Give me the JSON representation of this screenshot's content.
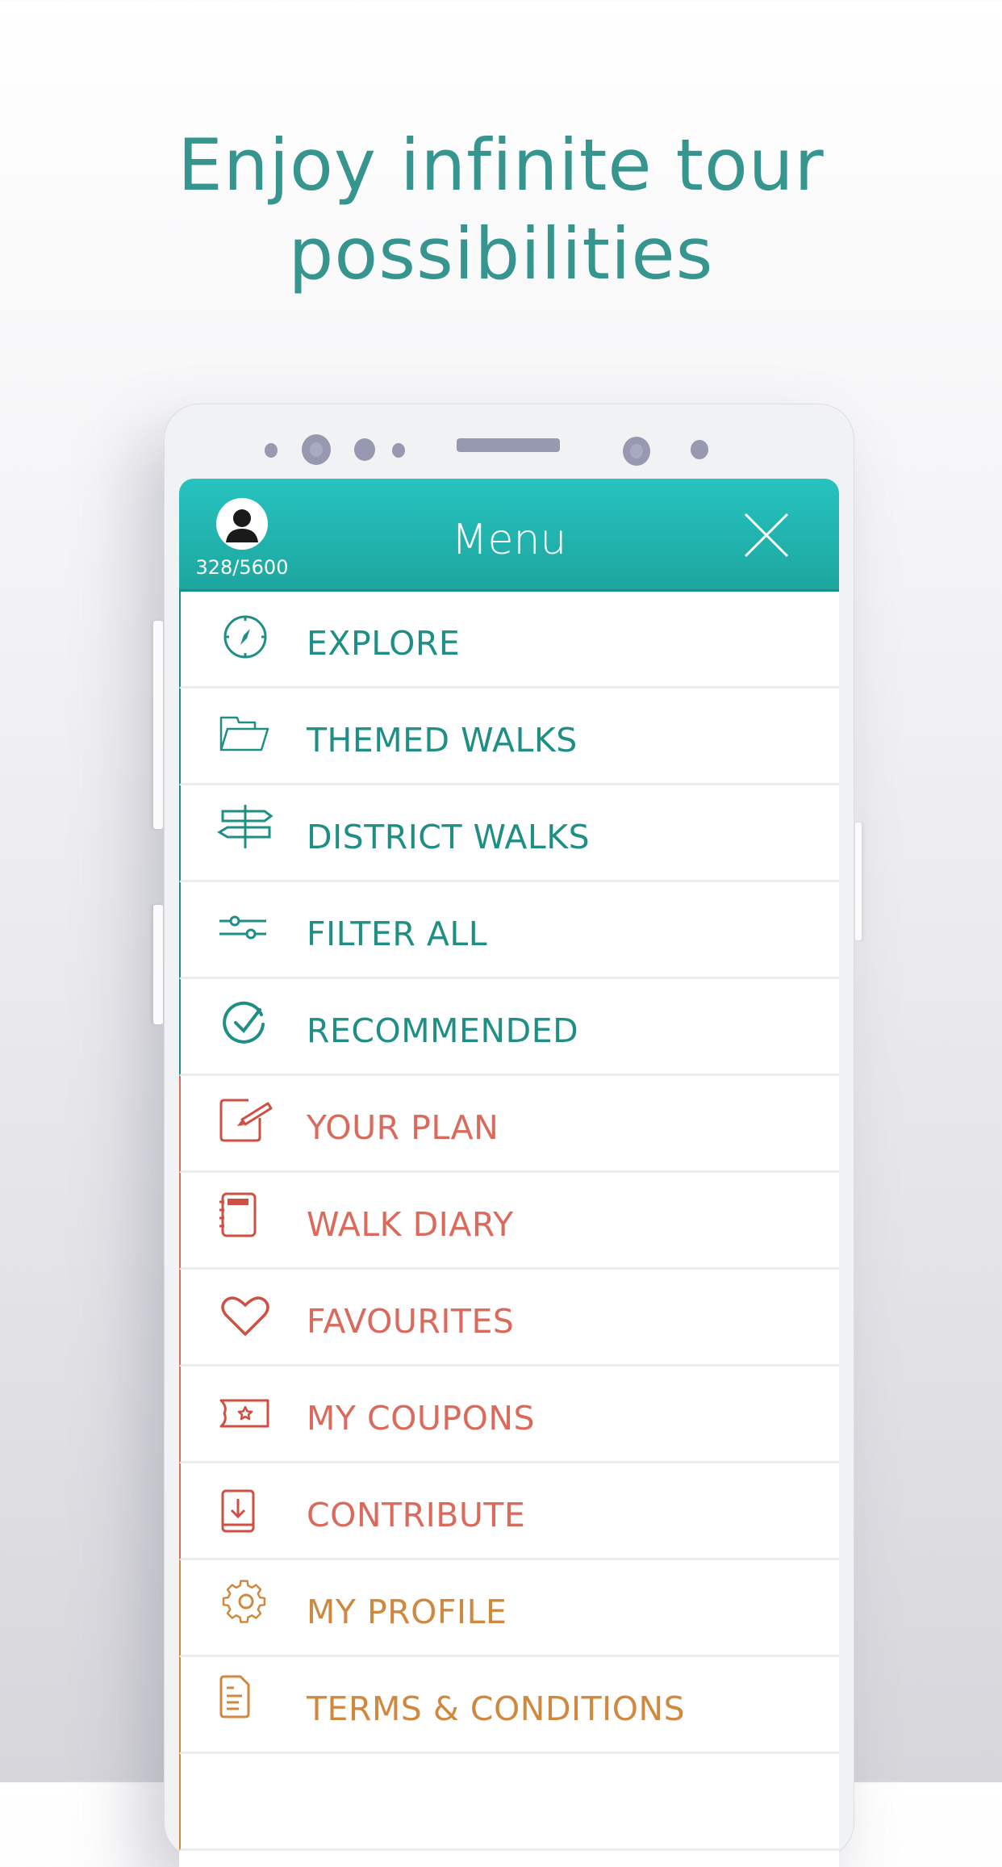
{
  "headline": {
    "line1": "Enjoy infinite tour",
    "line2": "possibilities"
  },
  "header": {
    "title": "Menu",
    "points": "328/5600",
    "avatar_icon": "user-avatar-icon",
    "close_icon": "close-icon"
  },
  "colors": {
    "teal": "#1f8f86",
    "coral": "#d96a5c",
    "orange": "#d0883f",
    "header_top": "#26c3c0",
    "header_bottom": "#1ea69f",
    "headline": "#36958e"
  },
  "menu": {
    "items": [
      {
        "label": "EXPLORE",
        "icon": "compass-icon"
      },
      {
        "label": "THEMED WALKS",
        "icon": "folder-icon"
      },
      {
        "label": "DISTRICT WALKS",
        "icon": "signpost-icon"
      },
      {
        "label": "FILTER ALL",
        "icon": "sliders-icon"
      },
      {
        "label": "RECOMMENDED",
        "icon": "check-circle-icon"
      },
      {
        "label": "YOUR PLAN",
        "icon": "edit-icon"
      },
      {
        "label": "WALK DIARY",
        "icon": "notebook-icon"
      },
      {
        "label": "FAVOURITES",
        "icon": "heart-icon"
      },
      {
        "label": "MY COUPONS",
        "icon": "coupon-icon"
      },
      {
        "label": "CONTRIBUTE",
        "icon": "download-book-icon"
      },
      {
        "label": "MY PROFILE",
        "icon": "gear-icon"
      },
      {
        "label": "TERMS & CONDITIONS",
        "icon": "document-icon"
      }
    ]
  }
}
